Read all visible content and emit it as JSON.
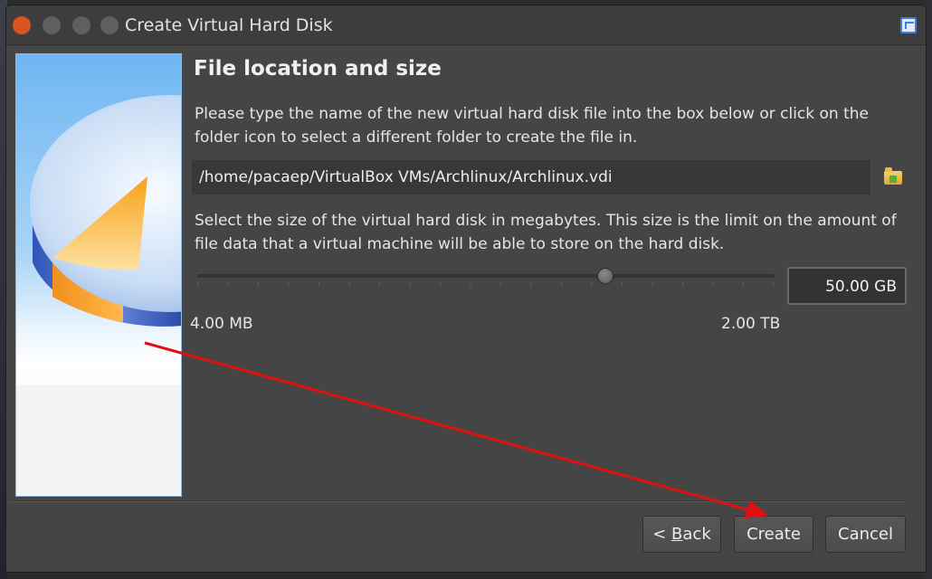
{
  "window": {
    "title": "Create Virtual Hard Disk",
    "app_icon": "virtualbox-icon"
  },
  "page": {
    "heading": "File location and size",
    "location_description": "Please type the name of the new virtual hard disk file into the box below or click on the folder icon to select a different folder to create the file in.",
    "file_path": "/home/pacaep/VirtualBox VMs/Archlinux/Archlinux.vdi",
    "folder_icon": "folder-icon",
    "size_description": "Select the size of the virtual hard disk in megabytes. This size is the limit on the amount of file data that a virtual machine will be able to store on the hard disk.",
    "size_value": "50.00 GB",
    "slider_min_label": "4.00 MB",
    "slider_max_label": "2.00 TB"
  },
  "buttons": {
    "back_prefix": "< ",
    "back_mnemonic": "B",
    "back_rest": "ack",
    "create": "Create",
    "cancel": "Cancel"
  },
  "colors": {
    "accent_close": "#d9531e",
    "annotation_arrow": "#e01010",
    "window_bg": "#454545"
  }
}
